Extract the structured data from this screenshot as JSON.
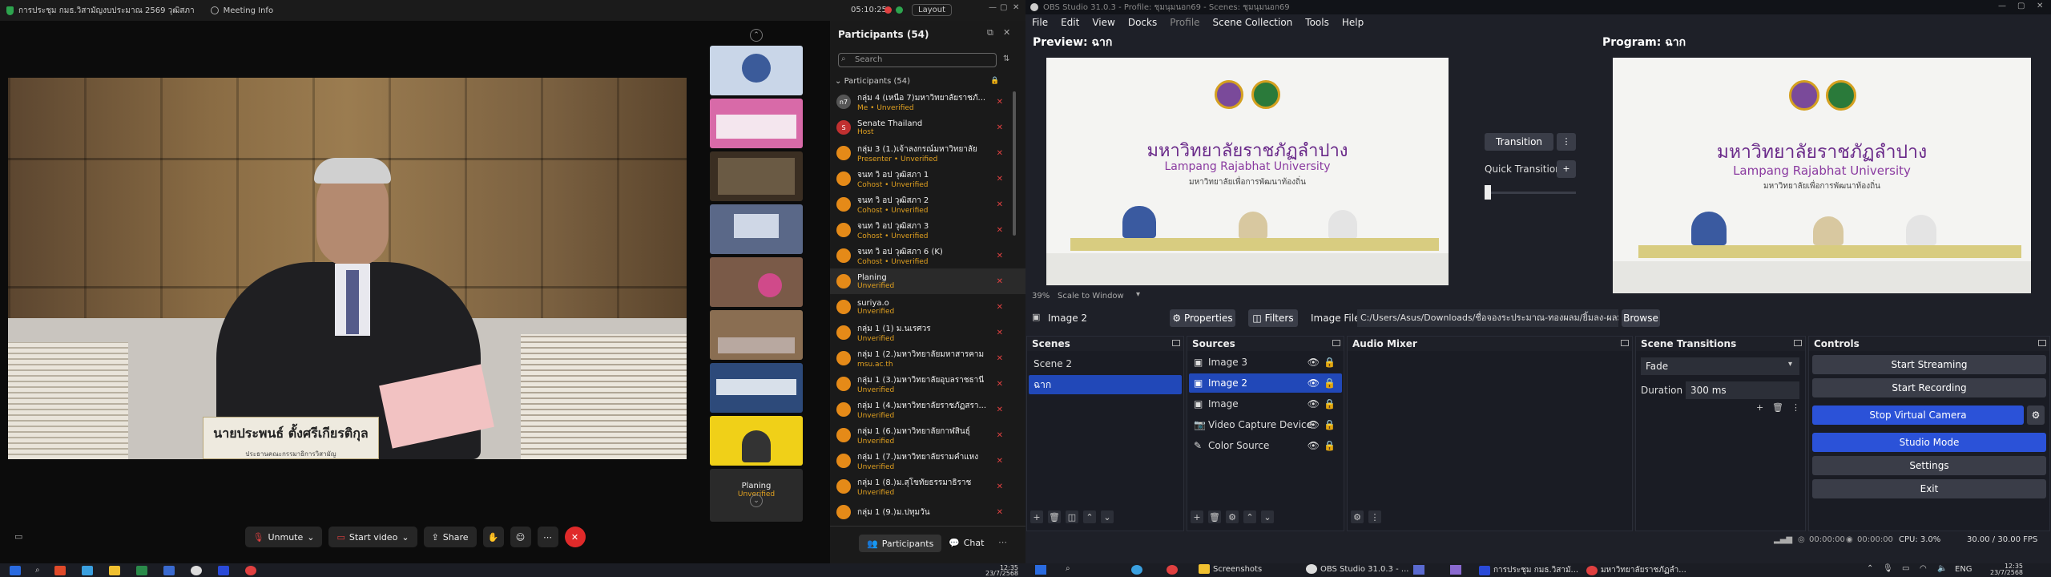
{
  "zoom": {
    "title": "การประชุม กมธ.วิสามัญงบประมาณ 2569 วุฒิสภา",
    "meeting_info": "Meeting Info",
    "time": "05:10:25",
    "layout_label": "Layout",
    "nameplate": "นายประพนธ์ ตั้งศรีเกียรติกุล",
    "nameplate_sub": "ประธานคณะกรรมาธิการวิสามัญ",
    "thumb_label": "Planing",
    "thumb_status": "Unverified",
    "controls": {
      "mute": "Unmute",
      "video": "Start video",
      "share": "Share"
    },
    "participants_title": "Participants (54)",
    "search_placeholder": "Search",
    "group_label": "Participants (54)",
    "participants": [
      {
        "initials": "n7",
        "name": "กลุ่ม 4 (เหนือ 7)มหาวิทยาลัยราชภั...",
        "status": "Me • Unverified"
      },
      {
        "initials": "S",
        "name": "Senate Thailand",
        "status": "Host"
      },
      {
        "initials": "",
        "name": "กลุ่ม 3 (1.)เจ้าลงกรณ์มหาวิทยาลัย",
        "status": "Presenter • Unverified"
      },
      {
        "initials": "",
        "name": "จนท วิ อป วุฒิสภา 1",
        "status": "Cohost • Unverified"
      },
      {
        "initials": "",
        "name": "จนท วิ อป วุฒิสภา 2",
        "status": "Cohost • Unverified"
      },
      {
        "initials": "",
        "name": "จนท วิ อป วุฒิสภา 3",
        "status": "Cohost • Unverified"
      },
      {
        "initials": "",
        "name": "จนท วิ อป วุฒิสภา 6 (K)",
        "status": "Cohost • Unverified"
      },
      {
        "initials": "",
        "name": "Planing",
        "status": "Unverified"
      },
      {
        "initials": "",
        "name": "suriya.o",
        "status": "Unverified"
      },
      {
        "initials": "",
        "name": "กลุ่ม 1 (1) ม.นเรศวร",
        "status": "Unverified"
      },
      {
        "initials": "",
        "name": "กลุ่ม 1 (2.)มหาวิทยาลัยมหาสารคาม",
        "status": "msu.ac.th"
      },
      {
        "initials": "",
        "name": "กลุ่ม 1 (3.)มหาวิทยาลัยอุบลราชธานี",
        "status": "Unverified"
      },
      {
        "initials": "",
        "name": "กลุ่ม 1 (4.)มหาวิทยาลัยราชภัฏสรา...",
        "status": "Unverified"
      },
      {
        "initials": "",
        "name": "กลุ่ม 1 (6.)มหาวิทยาลัยกาฬสินธุ์",
        "status": "Unverified"
      },
      {
        "initials": "",
        "name": "กลุ่ม 1 (7.)มหาวิทยาลัยรามคำแหง",
        "status": "Unverified"
      },
      {
        "initials": "",
        "name": "กลุ่ม 1 (8.)ม.สุโขทัยธรรมาธิราช",
        "status": "Unverified"
      },
      {
        "initials": "",
        "name": "กลุ่ม 1 (9.)ม.ปทุมวัน",
        "status": ""
      }
    ],
    "tab_participants": "Participants",
    "tab_chat": "Chat"
  },
  "obs": {
    "title": "OBS Studio 31.0.3 - Profile: ชุมนุมนอก69 - Scenes: ชุมนุมนอก69",
    "menu": [
      "File",
      "Edit",
      "View",
      "Docks",
      "Profile",
      "Scene Collection",
      "Tools",
      "Help"
    ],
    "preview_label": "Preview: ฉาก",
    "program_label": "Program: ฉาก",
    "uni_thai": "มหาวิทยาลัยราชภัฏลำปาง",
    "uni_en": "Lampang Rajabhat University",
    "uni_slogan": "มหาวิทยาลัยเพื่อการพัฒนาท้องถิ่น",
    "zoom_pct": "39%",
    "scale_label": "Scale to Window",
    "transition_btn": "Transition",
    "quick_transitions": "Quick Transitions",
    "source_name": "Image 2",
    "properties": "Properties",
    "filters": "Filters",
    "image_file_label": "Image File",
    "image_path": "C:/Users/Asus/Downloads/ชื่อจองระประมาณ-ทองผลม/ยิ้มลง-ผลม.png",
    "browse": "Browse",
    "docks": {
      "scenes": "Scenes",
      "sources": "Sources",
      "mixer": "Audio Mixer",
      "transitions": "Scene Transitions",
      "controls": "Controls"
    },
    "scenes": [
      "Scene 2",
      "ฉาก"
    ],
    "sources": [
      {
        "name": "Image 3",
        "icon": "image-icon"
      },
      {
        "name": "Image 2",
        "icon": "image-icon"
      },
      {
        "name": "Image",
        "icon": "image-icon"
      },
      {
        "name": "Video Capture Device",
        "icon": "camera-icon"
      },
      {
        "name": "Color Source",
        "icon": "brush-icon"
      }
    ],
    "transition_type": "Fade",
    "duration_label": "Duration",
    "duration_value": "300 ms",
    "controls": [
      "Start Streaming",
      "Start Recording",
      "Stop Virtual Camera",
      "Studio Mode",
      "Settings",
      "Exit"
    ],
    "status": {
      "stream_time": "00:00:00",
      "rec_time": "00:00:00",
      "cpu": "CPU: 3.0%",
      "fps": "30.00 / 30.00 FPS"
    }
  },
  "taskbar": {
    "time": "12:35",
    "date": "23/7/2568",
    "lang": "ENG",
    "apps": [
      "Screenshots",
      "OBS Studio 31.0.3 - ...",
      "การประชุม กมธ.วิสามั...",
      "มหาวิทยาลัยราชภัฏลำ..."
    ]
  }
}
